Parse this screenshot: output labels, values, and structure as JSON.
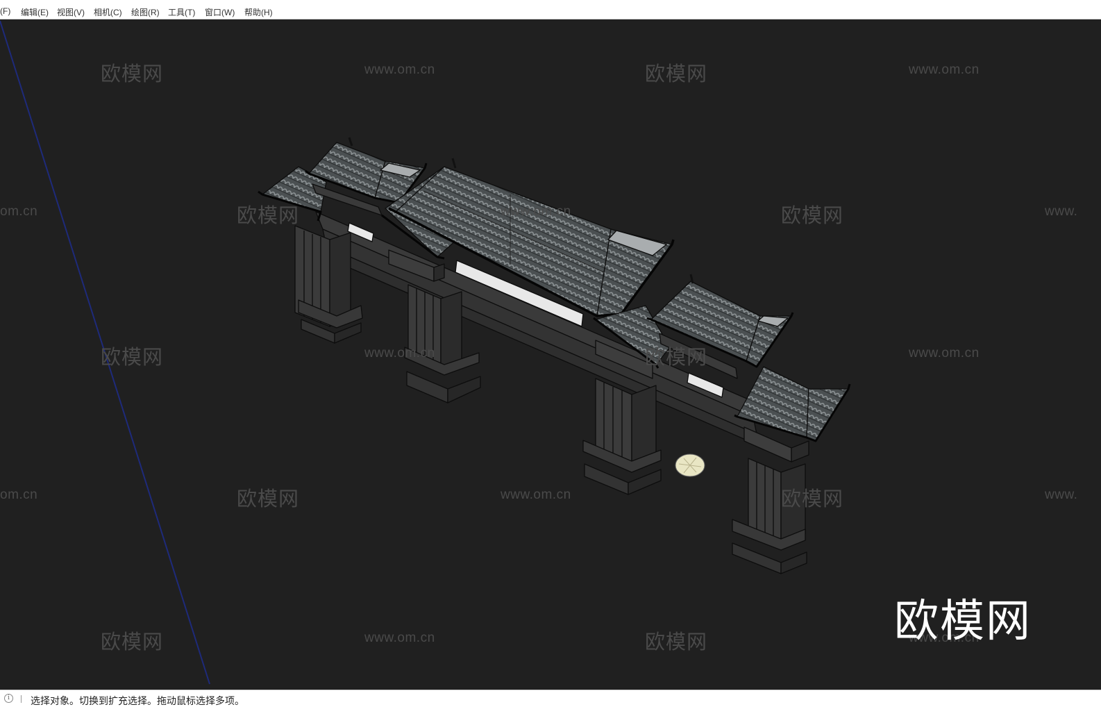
{
  "window": {
    "title": ""
  },
  "menu": {
    "items": [
      {
        "label": "(F)"
      },
      {
        "label": "编辑(E)"
      },
      {
        "label": "视图(V)"
      },
      {
        "label": "相机(C)"
      },
      {
        "label": "绘图(R)"
      },
      {
        "label": "工具(T)"
      },
      {
        "label": "窗口(W)"
      },
      {
        "label": "帮助(H)"
      }
    ]
  },
  "viewport": {
    "background": "#202020",
    "axis_color": "#1e2a7a",
    "model": "archway-gate",
    "watermarks": {
      "cn": [
        "欧模网",
        "欧模网",
        "欧模网",
        "欧模网",
        "欧模网",
        "欧模网",
        "欧模网",
        "欧模网",
        "欧模网",
        "欧模网",
        "欧模网",
        "欧模网"
      ],
      "url": [
        "www.om.cn",
        "www.om.cn",
        "om.cn",
        "www.om.cn",
        "www.",
        "www.om.cn",
        "www.om.cn",
        "om.cn",
        "www.om.cn",
        "www.",
        "www.om.cn",
        "www.om.cn"
      ]
    },
    "logo_text": "欧模网"
  },
  "status": {
    "icon": "info-icon",
    "text": "选择对象。切换到扩充选择。拖动鼠标选择多项。"
  }
}
